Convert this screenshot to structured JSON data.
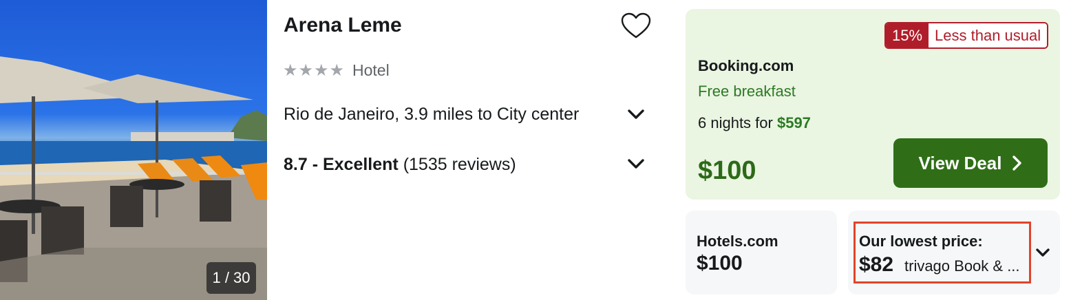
{
  "photo": {
    "counter": "1 / 30"
  },
  "hotel": {
    "name": "Arena Leme",
    "stars": "★★★★",
    "type": "Hotel",
    "location": "Rio de Janeiro, 3.9 miles to City center",
    "rating_score": "8.7 - Excellent",
    "rating_reviews": "(1535 reviews)"
  },
  "deal": {
    "badge_percent": "15%",
    "badge_text": "Less than usual",
    "provider": "Booking.com",
    "perk": "Free breakfast",
    "nights_text": "6 nights for",
    "nights_total": "$597",
    "price": "$100",
    "cta_label": "View Deal"
  },
  "alternative": {
    "provider": "Hotels.com",
    "price": "$100"
  },
  "lowest": {
    "title": "Our lowest price:",
    "price": "$82",
    "label": "trivago Book & ..."
  },
  "colors": {
    "deal_green": "#2f6e17",
    "deal_bg": "#eaf5e2",
    "badge_red": "#b01d2a",
    "highlight": "#e0442a"
  }
}
